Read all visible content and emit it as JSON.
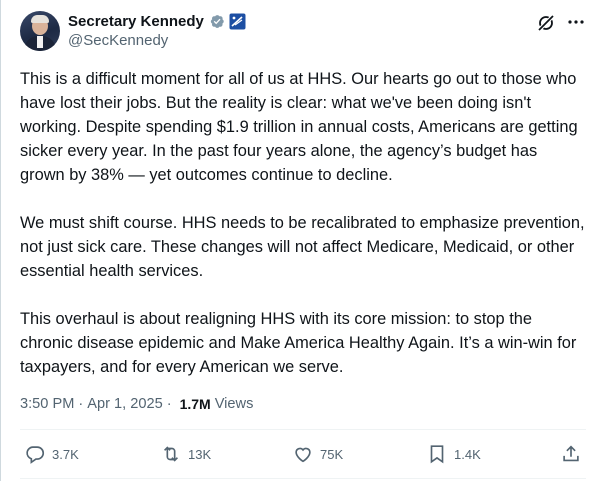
{
  "author": {
    "display_name": "Secretary Kennedy",
    "handle": "@SecKennedy",
    "verified_badge_icon": "verified-grey-badge-icon",
    "affiliation_icon": "us-flag-affiliation-icon"
  },
  "header_icons": {
    "grok": "grok-icon",
    "more": "more-options-icon"
  },
  "post": {
    "paragraphs": [
      "This is a difficult moment for all of us at HHS. Our hearts go out to those who have lost their jobs. But the reality is clear: what we've been doing isn't working. Despite spending $1.9 trillion in annual costs, Americans are getting sicker every year. In the past four years alone, the agency’s budget has grown by 38% — yet outcomes continue to decline.",
      "We must shift course. HHS needs to be recalibrated to emphasize prevention, not just sick care. These changes will not affect Medicare, Medicaid, or other essential health services.",
      "This overhaul is about realigning HHS with its core mission: to stop the chronic disease epidemic and Make America Healthy Again. It’s a win-win for taxpayers, and for every American we serve."
    ],
    "time": "3:50 PM",
    "separator": "·",
    "date": "Apr 1, 2025",
    "views_count": "1.7M",
    "views_label": "Views"
  },
  "actions": {
    "replies": "3.7K",
    "reposts": "13K",
    "likes": "75K",
    "bookmarks": "1.4K"
  },
  "colors": {
    "text": "#0f1419",
    "secondary": "#536471",
    "divider": "#eff3f4",
    "badge_grey": "#829aab",
    "badge_blue": "#1d9bf0"
  }
}
